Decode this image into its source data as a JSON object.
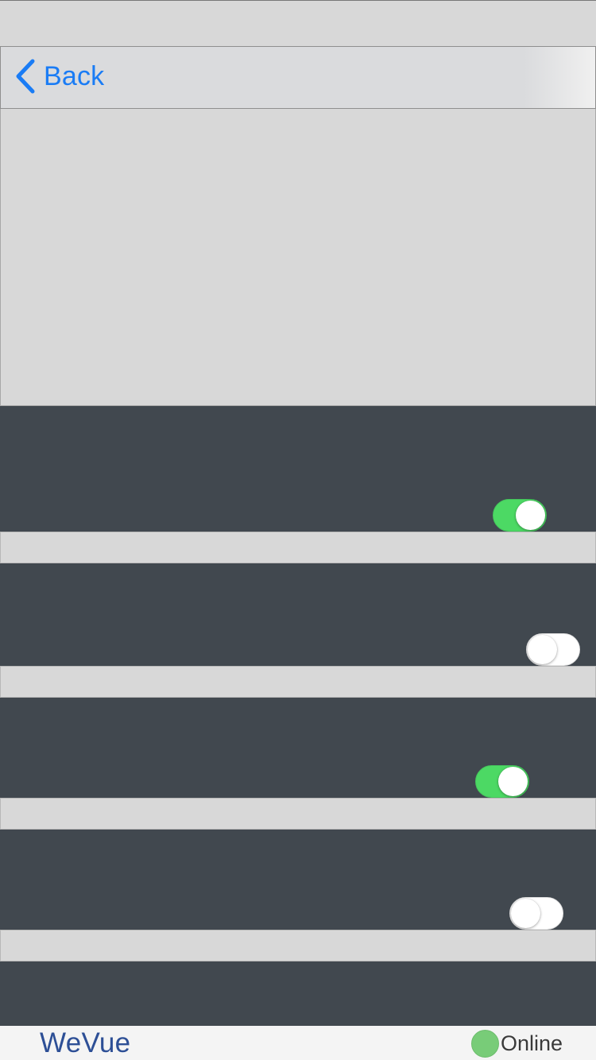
{
  "nav": {
    "back_label": "Back",
    "back_icon": "chevron-left-icon"
  },
  "colors": {
    "accent": "#1a7cf5",
    "dark_row": "#41484f",
    "background": "#d8d8d8",
    "toggle_on": "#4cd964",
    "brand": "#2d4f96",
    "online": "#78cc78"
  },
  "toggles": [
    {
      "on": true
    },
    {
      "on": false
    },
    {
      "on": true
    },
    {
      "on": false
    }
  ],
  "footer": {
    "brand": "WeVue",
    "status_label": "Online"
  }
}
